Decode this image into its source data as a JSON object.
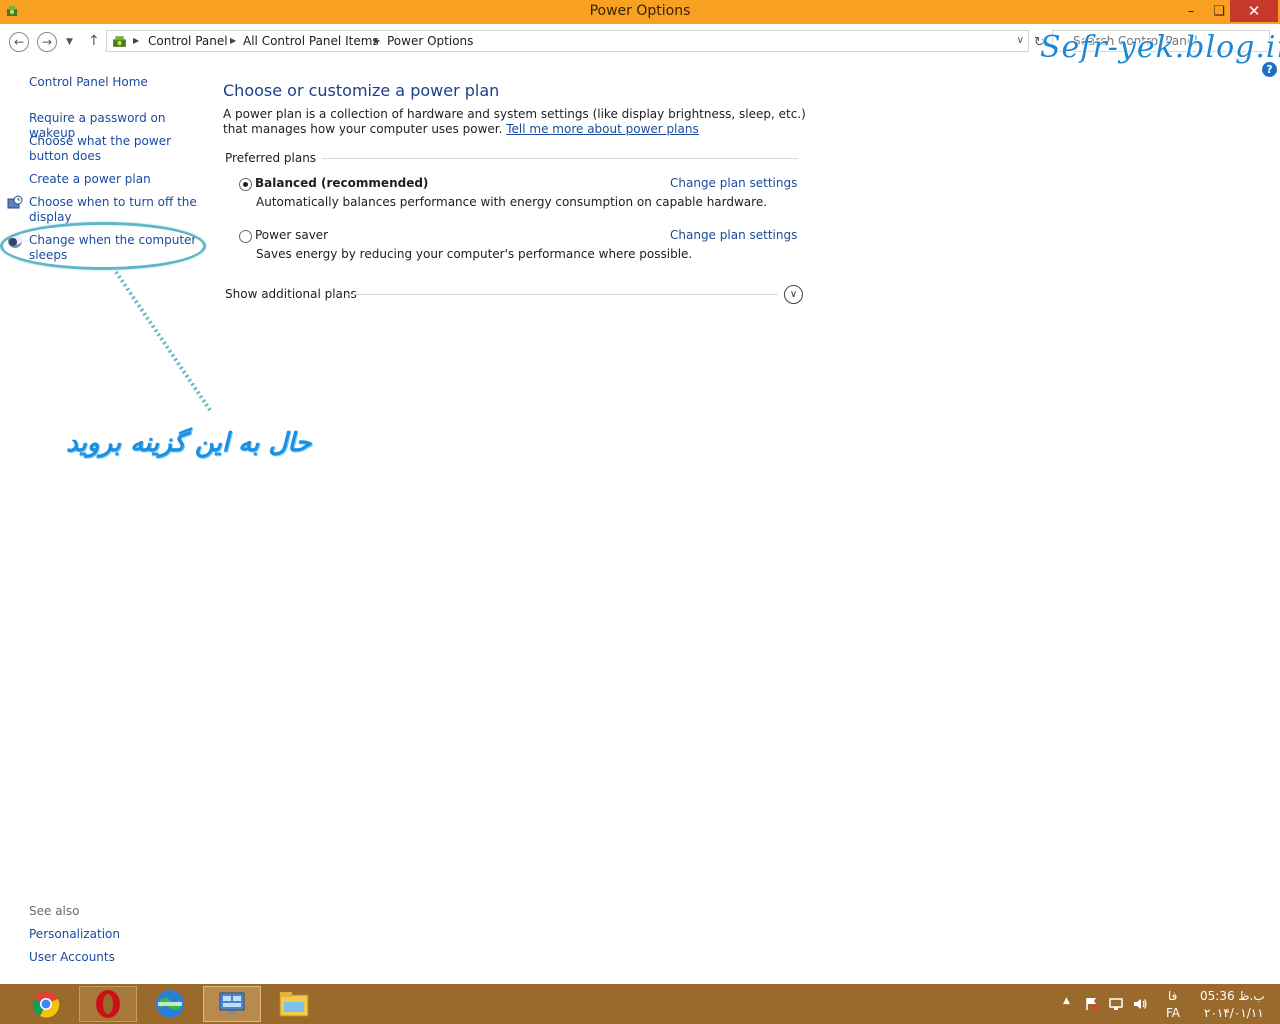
{
  "window": {
    "title": "Power Options",
    "controls": {
      "minimize": "–",
      "maximize": "❏",
      "close": "✕"
    },
    "accent": "#f7a021"
  },
  "nav": {
    "back": "←",
    "forward": "→",
    "recent": "▼",
    "up": "↑",
    "breadcrumbs": [
      "Control Panel",
      "All Control Panel Items",
      "Power Options"
    ],
    "crumb_sep": "▶",
    "address_dropdown": "∨",
    "refresh": "↻",
    "search_placeholder": "Search Control Panel"
  },
  "watermark": "Sefr-yek.blog.ir",
  "help": "?",
  "sidebar": {
    "home": "Control Panel Home",
    "links": [
      "Require a password on wakeup",
      "Choose what the power button does",
      "Create a power plan",
      "Choose when to turn off the display",
      "Change when the computer sleeps"
    ],
    "see_also_label": "See also",
    "see_also": [
      "Personalization",
      "User Accounts"
    ]
  },
  "annotation": {
    "text": "حال به این گزینه بروید",
    "color": "#1d8fe0"
  },
  "main": {
    "title": "Choose or customize a power plan",
    "description": "A power plan is a collection of hardware and system settings (like display brightness, sleep, etc.) that manages how your computer uses power.",
    "learn_more": "Tell me more about power plans",
    "preferred_label": "Preferred plans",
    "plans": [
      {
        "name": "Balanced (recommended)",
        "description": "Automatically balances performance with energy consumption on capable hardware.",
        "selected": true,
        "link": "Change plan settings"
      },
      {
        "name": "Power saver",
        "description": "Saves energy by reducing your computer's performance where possible.",
        "selected": false,
        "link": "Change plan settings"
      }
    ],
    "additional_label": "Show additional plans",
    "expand_glyph": "∨"
  },
  "taskbar": {
    "apps": [
      "chrome-icon",
      "opera-icon",
      "globe-app-icon",
      "control-panel-icon",
      "file-explorer-icon"
    ],
    "tray": {
      "show_hidden": "▲",
      "lang_fa": "فا",
      "lang_en": "FA",
      "time": "05:36 ب.ظ",
      "date": "۲۰۱۴/۰۱/۱۱"
    },
    "color": "#9a6a2c"
  }
}
